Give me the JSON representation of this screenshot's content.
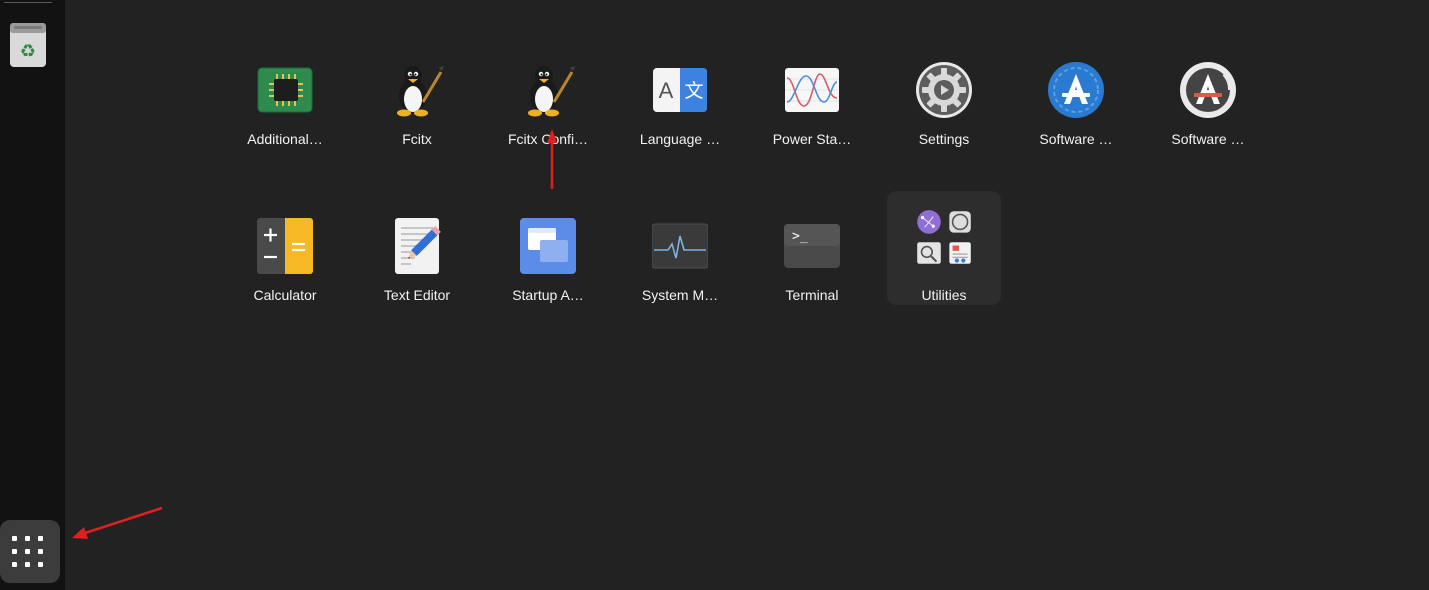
{
  "dock": {
    "trash_icon": "trash-icon",
    "show_apps_icon": "app-grid-icon"
  },
  "apps": {
    "row1": [
      {
        "label": "Additional…",
        "icon": "chip-icon"
      },
      {
        "label": "Fcitx",
        "icon": "tux-icon"
      },
      {
        "label": "Fcitx Confi…",
        "icon": "tux-icon"
      },
      {
        "label": "Language …",
        "icon": "language-icon"
      },
      {
        "label": "Power Sta…",
        "icon": "power-stats-icon"
      },
      {
        "label": "Settings",
        "icon": "gear-icon"
      },
      {
        "label": "Software …",
        "icon": "software-icon"
      },
      {
        "label": "Software …",
        "icon": "software-updater-icon"
      }
    ],
    "row2": [
      {
        "label": "Calculator",
        "icon": "calculator-icon"
      },
      {
        "label": "Text Editor",
        "icon": "text-editor-icon"
      },
      {
        "label": "Startup A…",
        "icon": "startup-apps-icon"
      },
      {
        "label": "System M…",
        "icon": "system-monitor-icon"
      },
      {
        "label": "Terminal",
        "icon": "terminal-icon"
      },
      {
        "label": "Utilities",
        "icon": "folder-icon"
      }
    ]
  },
  "colors": {
    "background": "#222222",
    "dock": "#121212",
    "annotation_arrow": "#e02020"
  }
}
